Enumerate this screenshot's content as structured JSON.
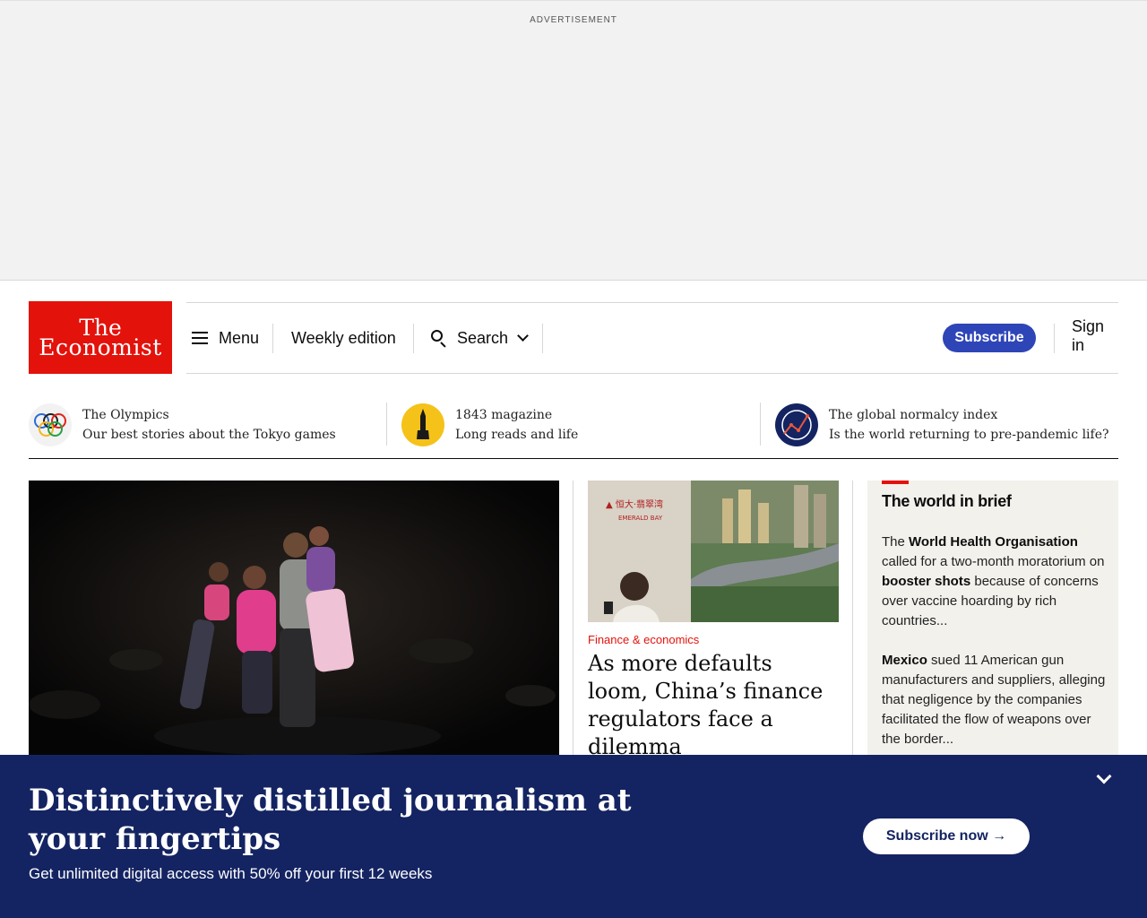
{
  "ad": {
    "label": "ADVERTISEMENT"
  },
  "header": {
    "logo_line1": "The",
    "logo_line2": "Economist",
    "menu_label": "Menu",
    "weekly_label": "Weekly edition",
    "search_label": "Search",
    "subscribe_label": "Subscribe",
    "signin_label": "Sign in"
  },
  "promos": [
    {
      "title": "The Olympics",
      "subtitle": "Our best stories about the Tokyo games",
      "icon": "olympic-rings-icon"
    },
    {
      "title": "1843 magazine",
      "subtitle": "Long reads and life",
      "icon": "1843-magazine-icon"
    },
    {
      "title": "The global normalcy index",
      "subtitle": "Is the world returning to pre-pandemic life?",
      "icon": "normalcy-index-icon"
    }
  ],
  "story": {
    "section": "Finance & economics",
    "headline": "As more defaults loom, China’s finance regulators face a dilemma"
  },
  "brief": {
    "title": "The world in brief",
    "item1": {
      "pre": "The ",
      "b1": "World Health Organisation",
      "mid": " called for a two-month moratorium on ",
      "b2": "booster shots",
      "post": " because of concerns over vaccine hoarding by rich countries..."
    },
    "item2": {
      "b1": "Mexico",
      "post": " sued 11 American gun manufacturers and suppliers, alleging that negligence by the companies facilitated the flow of weapons over the border..."
    }
  },
  "banner": {
    "title": "Distinctively distilled journalism at your fingertips",
    "subtitle": "Get unlimited digital access with 50% off your first 12 weeks",
    "button_label": "Subscribe now →"
  },
  "colors": {
    "economist_red": "#e3120b",
    "banner_blue": "#142462",
    "subscribe_blue": "#2e45b8"
  }
}
